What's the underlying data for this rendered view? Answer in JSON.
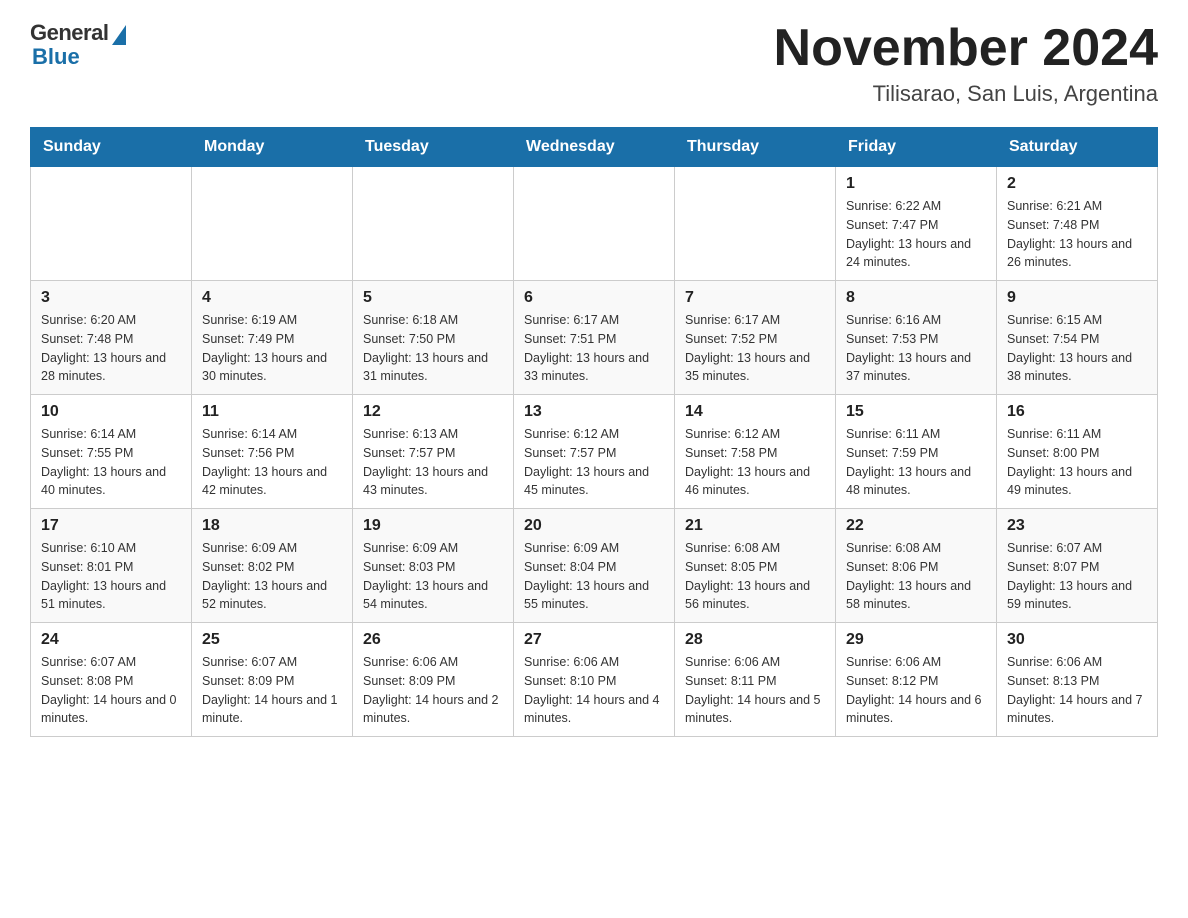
{
  "logo": {
    "general": "General",
    "blue": "Blue"
  },
  "title": "November 2024",
  "location": "Tilisarao, San Luis, Argentina",
  "days_of_week": [
    "Sunday",
    "Monday",
    "Tuesday",
    "Wednesday",
    "Thursday",
    "Friday",
    "Saturday"
  ],
  "weeks": [
    [
      {
        "day": "",
        "sunrise": "",
        "sunset": "",
        "daylight": ""
      },
      {
        "day": "",
        "sunrise": "",
        "sunset": "",
        "daylight": ""
      },
      {
        "day": "",
        "sunrise": "",
        "sunset": "",
        "daylight": ""
      },
      {
        "day": "",
        "sunrise": "",
        "sunset": "",
        "daylight": ""
      },
      {
        "day": "",
        "sunrise": "",
        "sunset": "",
        "daylight": ""
      },
      {
        "day": "1",
        "sunrise": "Sunrise: 6:22 AM",
        "sunset": "Sunset: 7:47 PM",
        "daylight": "Daylight: 13 hours and 24 minutes."
      },
      {
        "day": "2",
        "sunrise": "Sunrise: 6:21 AM",
        "sunset": "Sunset: 7:48 PM",
        "daylight": "Daylight: 13 hours and 26 minutes."
      }
    ],
    [
      {
        "day": "3",
        "sunrise": "Sunrise: 6:20 AM",
        "sunset": "Sunset: 7:48 PM",
        "daylight": "Daylight: 13 hours and 28 minutes."
      },
      {
        "day": "4",
        "sunrise": "Sunrise: 6:19 AM",
        "sunset": "Sunset: 7:49 PM",
        "daylight": "Daylight: 13 hours and 30 minutes."
      },
      {
        "day": "5",
        "sunrise": "Sunrise: 6:18 AM",
        "sunset": "Sunset: 7:50 PM",
        "daylight": "Daylight: 13 hours and 31 minutes."
      },
      {
        "day": "6",
        "sunrise": "Sunrise: 6:17 AM",
        "sunset": "Sunset: 7:51 PM",
        "daylight": "Daylight: 13 hours and 33 minutes."
      },
      {
        "day": "7",
        "sunrise": "Sunrise: 6:17 AM",
        "sunset": "Sunset: 7:52 PM",
        "daylight": "Daylight: 13 hours and 35 minutes."
      },
      {
        "day": "8",
        "sunrise": "Sunrise: 6:16 AM",
        "sunset": "Sunset: 7:53 PM",
        "daylight": "Daylight: 13 hours and 37 minutes."
      },
      {
        "day": "9",
        "sunrise": "Sunrise: 6:15 AM",
        "sunset": "Sunset: 7:54 PM",
        "daylight": "Daylight: 13 hours and 38 minutes."
      }
    ],
    [
      {
        "day": "10",
        "sunrise": "Sunrise: 6:14 AM",
        "sunset": "Sunset: 7:55 PM",
        "daylight": "Daylight: 13 hours and 40 minutes."
      },
      {
        "day": "11",
        "sunrise": "Sunrise: 6:14 AM",
        "sunset": "Sunset: 7:56 PM",
        "daylight": "Daylight: 13 hours and 42 minutes."
      },
      {
        "day": "12",
        "sunrise": "Sunrise: 6:13 AM",
        "sunset": "Sunset: 7:57 PM",
        "daylight": "Daylight: 13 hours and 43 minutes."
      },
      {
        "day": "13",
        "sunrise": "Sunrise: 6:12 AM",
        "sunset": "Sunset: 7:57 PM",
        "daylight": "Daylight: 13 hours and 45 minutes."
      },
      {
        "day": "14",
        "sunrise": "Sunrise: 6:12 AM",
        "sunset": "Sunset: 7:58 PM",
        "daylight": "Daylight: 13 hours and 46 minutes."
      },
      {
        "day": "15",
        "sunrise": "Sunrise: 6:11 AM",
        "sunset": "Sunset: 7:59 PM",
        "daylight": "Daylight: 13 hours and 48 minutes."
      },
      {
        "day": "16",
        "sunrise": "Sunrise: 6:11 AM",
        "sunset": "Sunset: 8:00 PM",
        "daylight": "Daylight: 13 hours and 49 minutes."
      }
    ],
    [
      {
        "day": "17",
        "sunrise": "Sunrise: 6:10 AM",
        "sunset": "Sunset: 8:01 PM",
        "daylight": "Daylight: 13 hours and 51 minutes."
      },
      {
        "day": "18",
        "sunrise": "Sunrise: 6:09 AM",
        "sunset": "Sunset: 8:02 PM",
        "daylight": "Daylight: 13 hours and 52 minutes."
      },
      {
        "day": "19",
        "sunrise": "Sunrise: 6:09 AM",
        "sunset": "Sunset: 8:03 PM",
        "daylight": "Daylight: 13 hours and 54 minutes."
      },
      {
        "day": "20",
        "sunrise": "Sunrise: 6:09 AM",
        "sunset": "Sunset: 8:04 PM",
        "daylight": "Daylight: 13 hours and 55 minutes."
      },
      {
        "day": "21",
        "sunrise": "Sunrise: 6:08 AM",
        "sunset": "Sunset: 8:05 PM",
        "daylight": "Daylight: 13 hours and 56 minutes."
      },
      {
        "day": "22",
        "sunrise": "Sunrise: 6:08 AM",
        "sunset": "Sunset: 8:06 PM",
        "daylight": "Daylight: 13 hours and 58 minutes."
      },
      {
        "day": "23",
        "sunrise": "Sunrise: 6:07 AM",
        "sunset": "Sunset: 8:07 PM",
        "daylight": "Daylight: 13 hours and 59 minutes."
      }
    ],
    [
      {
        "day": "24",
        "sunrise": "Sunrise: 6:07 AM",
        "sunset": "Sunset: 8:08 PM",
        "daylight": "Daylight: 14 hours and 0 minutes."
      },
      {
        "day": "25",
        "sunrise": "Sunrise: 6:07 AM",
        "sunset": "Sunset: 8:09 PM",
        "daylight": "Daylight: 14 hours and 1 minute."
      },
      {
        "day": "26",
        "sunrise": "Sunrise: 6:06 AM",
        "sunset": "Sunset: 8:09 PM",
        "daylight": "Daylight: 14 hours and 2 minutes."
      },
      {
        "day": "27",
        "sunrise": "Sunrise: 6:06 AM",
        "sunset": "Sunset: 8:10 PM",
        "daylight": "Daylight: 14 hours and 4 minutes."
      },
      {
        "day": "28",
        "sunrise": "Sunrise: 6:06 AM",
        "sunset": "Sunset: 8:11 PM",
        "daylight": "Daylight: 14 hours and 5 minutes."
      },
      {
        "day": "29",
        "sunrise": "Sunrise: 6:06 AM",
        "sunset": "Sunset: 8:12 PM",
        "daylight": "Daylight: 14 hours and 6 minutes."
      },
      {
        "day": "30",
        "sunrise": "Sunrise: 6:06 AM",
        "sunset": "Sunset: 8:13 PM",
        "daylight": "Daylight: 14 hours and 7 minutes."
      }
    ]
  ]
}
